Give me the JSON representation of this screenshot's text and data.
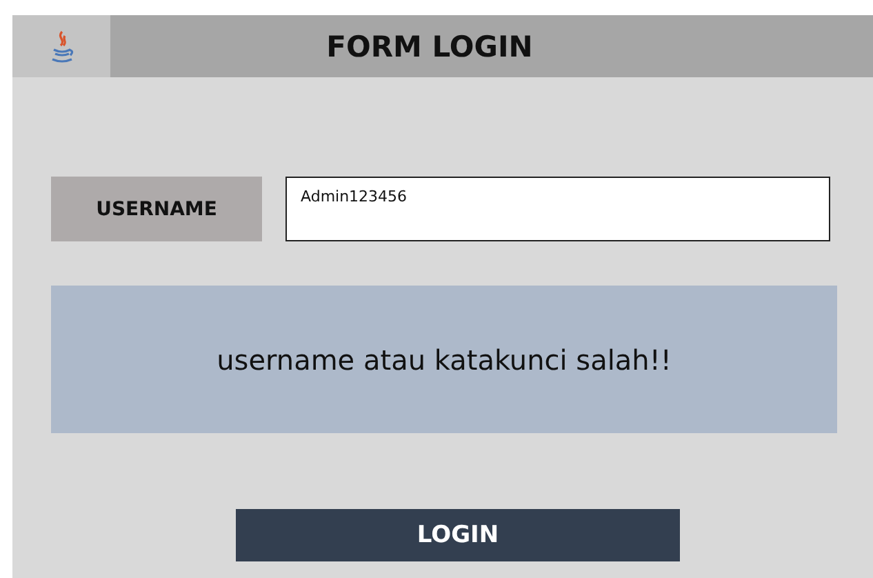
{
  "window": {
    "title": "FORM LOGIN"
  },
  "username": {
    "label": "USERNAME",
    "value": "Admin123456"
  },
  "message": "username atau katakunci salah!!",
  "buttons": [
    "LOGIN"
  ]
}
